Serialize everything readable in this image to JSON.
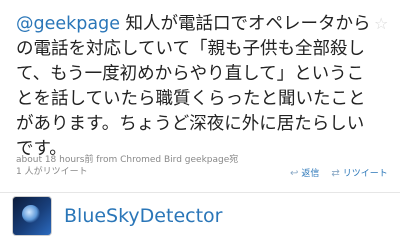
{
  "tweet": {
    "mention": "@geekpage",
    "text_after_mention": " 知人が電話口でオペレータからの電話を対応していて「親も子供も全部殺して、もう一度初めからやり直して」ということを話していたら職質くらったと聞いたことがあります。ちょうど深夜に外に居たらしいです。",
    "meta": "about 18 hours前 from Chromed Bird geekpage宛",
    "retweet_count": "1 人がリツイート",
    "reply_label": "返信",
    "retweet_label": "リツイート"
  },
  "profile": {
    "username": "BlueSkyDetector"
  }
}
